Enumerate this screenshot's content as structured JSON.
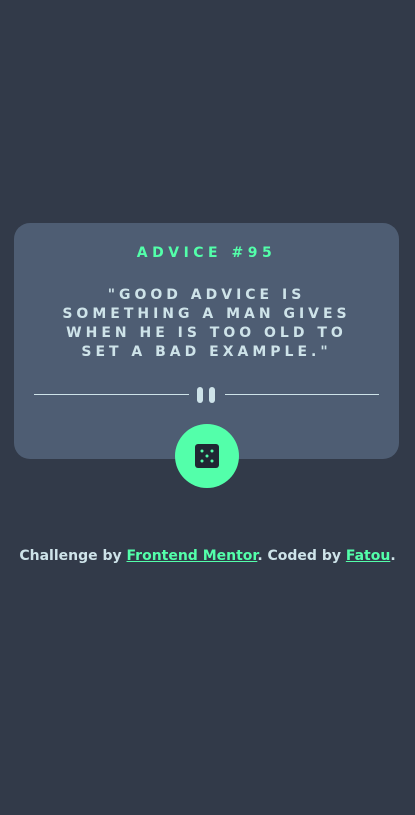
{
  "card": {
    "title": "ADVICE #95",
    "quote": "\"GOOD ADVICE IS SOMETHING A MAN GIVES WHEN HE IS TOO OLD TO SET A BAD EXAMPLE.\""
  },
  "icons": {
    "divider": "pause-icon",
    "dice": "dice-icon"
  },
  "colors": {
    "background": "#323a49",
    "card": "#4e5d73",
    "accent": "#53ffaa",
    "text": "#cee3e9"
  },
  "footer": {
    "prefix": "Challenge by ",
    "frontend_link": "Frontend Mentor",
    "middle": ". Coded by ",
    "author_link": "Fatou",
    "suffix": "."
  }
}
